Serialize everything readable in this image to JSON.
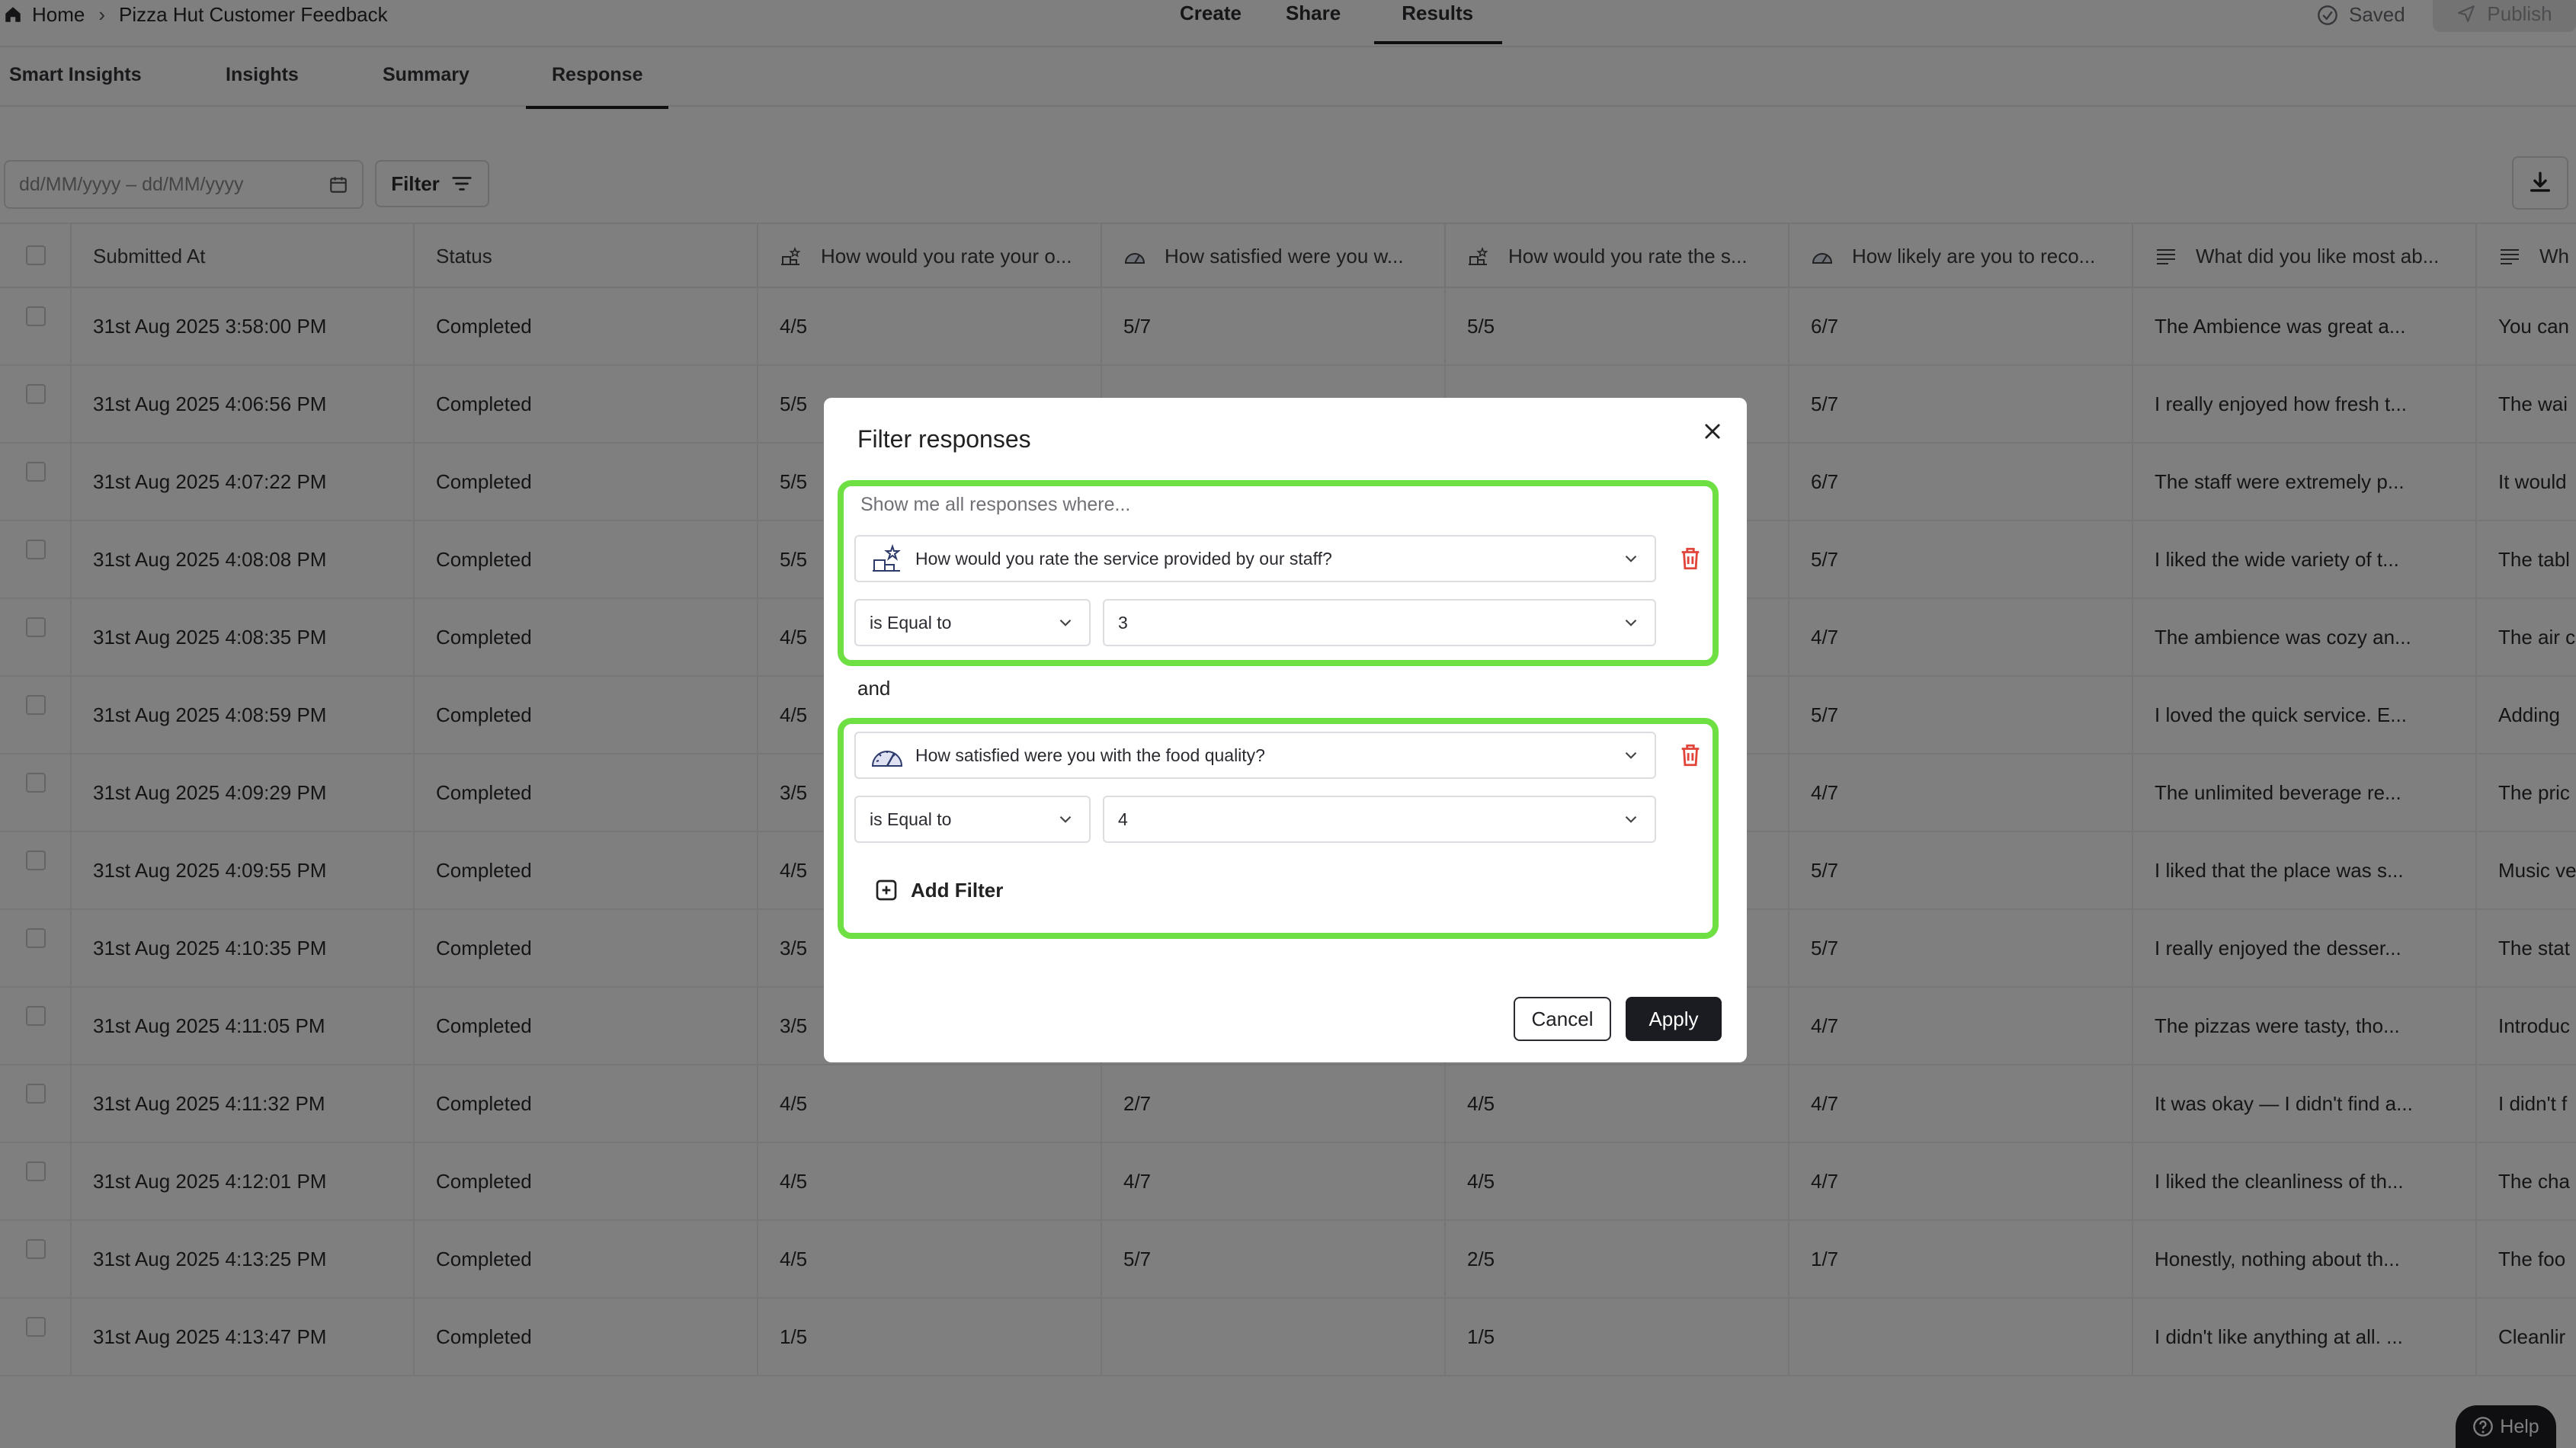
{
  "breadcrumb": {
    "home": "Home",
    "form_title": "Pizza Hut Customer Feedback"
  },
  "main_tabs": [
    "Create",
    "Share",
    "Results"
  ],
  "status": {
    "saved": "Saved",
    "publish": "Publish"
  },
  "sub_tabs": [
    "Smart Insights",
    "Insights",
    "Summary",
    "Response"
  ],
  "toolbar": {
    "date_placeholder": "dd/MM/yyyy – dd/MM/yyyy",
    "filter_label": "Filter"
  },
  "table": {
    "headers": [
      "Submitted At",
      "Status",
      "How would you rate your o...",
      "How satisfied were you w...",
      "How would you rate the s...",
      "How likely are you to reco...",
      "What did you like most ab...",
      "Wh"
    ],
    "rows": [
      [
        "31st Aug 2025 3:58:00 PM",
        "Completed",
        "4/5",
        "5/7",
        "5/5",
        "6/7",
        "The Ambience was great a...",
        "You can"
      ],
      [
        "31st Aug 2025 4:06:56 PM",
        "Completed",
        "5/5",
        "",
        "",
        "5/7",
        "I really enjoyed how fresh t...",
        "The wai"
      ],
      [
        "31st Aug 2025 4:07:22 PM",
        "Completed",
        "5/5",
        "",
        "",
        "6/7",
        "The staff were extremely p...",
        "It would"
      ],
      [
        "31st Aug 2025 4:08:08 PM",
        "Completed",
        "5/5",
        "",
        "",
        "5/7",
        "I liked the wide variety of t...",
        "The tabl"
      ],
      [
        "31st Aug 2025 4:08:35 PM",
        "Completed",
        "4/5",
        "",
        "",
        "4/7",
        "The ambience was cozy an...",
        "The air c"
      ],
      [
        "31st Aug 2025 4:08:59 PM",
        "Completed",
        "4/5",
        "",
        "",
        "5/7",
        "I loved the quick service. E...",
        "Adding"
      ],
      [
        "31st Aug 2025 4:09:29 PM",
        "Completed",
        "3/5",
        "",
        "",
        "4/7",
        "The unlimited beverage re...",
        "The pric"
      ],
      [
        "31st Aug 2025 4:09:55 PM",
        "Completed",
        "4/5",
        "",
        "",
        "5/7",
        "I liked that the place was s...",
        "Music ve"
      ],
      [
        "31st Aug 2025 4:10:35 PM",
        "Completed",
        "3/5",
        "",
        "",
        "5/7",
        "I really enjoyed the desser...",
        "The stat"
      ],
      [
        "31st Aug 2025 4:11:05 PM",
        "Completed",
        "3/5",
        "",
        "",
        "4/7",
        "The pizzas were tasty, tho...",
        "Introduc"
      ],
      [
        "31st Aug 2025 4:11:32 PM",
        "Completed",
        "4/5",
        "2/7",
        "4/5",
        "4/7",
        "It was okay — I didn't find a...",
        "I didn't f"
      ],
      [
        "31st Aug 2025 4:12:01 PM",
        "Completed",
        "4/5",
        "4/7",
        "4/5",
        "4/7",
        "I liked the cleanliness of th...",
        "The cha"
      ],
      [
        "31st Aug 2025 4:13:25 PM",
        "Completed",
        "4/5",
        "5/7",
        "2/5",
        "1/7",
        "Honestly, nothing about th...",
        "The foo"
      ],
      [
        "31st Aug 2025 4:13:47 PM",
        "Completed",
        "1/5",
        "",
        "1/5",
        "",
        "I didn't like anything at all. ...",
        "Cleanlir"
      ]
    ]
  },
  "help_label": "Help",
  "modal": {
    "title": "Filter responses",
    "hint": "Show me all responses where...",
    "filters": [
      {
        "question": "How would you rate the service provided by our staff?",
        "operator": "is Equal to",
        "value": "3"
      },
      {
        "question": "How satisfied were you with the food quality?",
        "operator": "is Equal to",
        "value": "4"
      }
    ],
    "joiner": "and",
    "add_filter": "Add Filter",
    "cancel": "Cancel",
    "apply": "Apply"
  },
  "colors": {
    "highlight": "#6ee044",
    "danger": "#e0443a",
    "primary": "#1b1c21"
  }
}
